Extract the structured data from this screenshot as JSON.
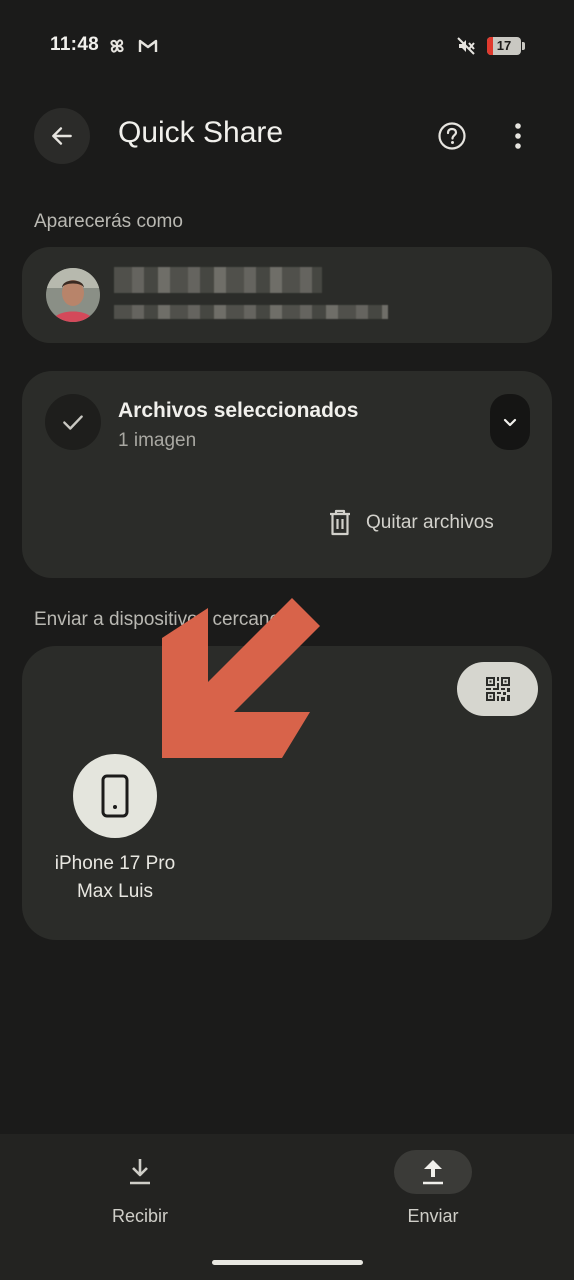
{
  "status_bar": {
    "time": "11:48",
    "battery_level": "17",
    "battery_fraction": 0.17,
    "icons": [
      "pinwheel-icon",
      "gmail-icon",
      "mute-icon",
      "battery-icon"
    ]
  },
  "header": {
    "title": "Quick Share",
    "back_icon": "arrow-back-icon",
    "help_icon": "help-circle-icon",
    "more_icon": "more-vert-icon"
  },
  "profile": {
    "section_label": "Aparecerás como"
  },
  "files": {
    "title": "Archivos seleccionados",
    "subtitle": "1 imagen",
    "remove_label": "Quitar archivos"
  },
  "devices": {
    "section_label": "Enviar a dispositivos cercanos",
    "items": [
      {
        "name": "iPhone 17 Pro Max Luis",
        "icon": "smartphone-icon"
      }
    ]
  },
  "bottom_nav": {
    "items": [
      {
        "label": "Recibir",
        "icon": "download-icon",
        "active": false
      },
      {
        "label": "Enviar",
        "icon": "upload-icon",
        "active": true
      }
    ]
  },
  "colors": {
    "background": "#1b1b1a",
    "card": "#2b2c29",
    "annotation": "#d8634a",
    "battery_low": "#e03a2e"
  }
}
